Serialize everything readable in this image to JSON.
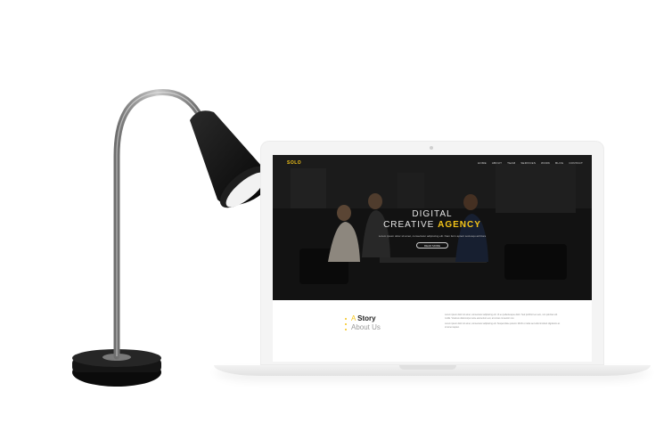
{
  "site": {
    "logo": "SOLO",
    "nav": [
      "HOME",
      "ABOUT",
      "TEAM",
      "SERVICES",
      "WORK",
      "BLOG",
      "CONTACT"
    ]
  },
  "hero": {
    "title_line1": "DIGITAL",
    "title_line2_prefix": "CREATIVE",
    "title_line2_highlight": "AGENCY",
    "subtitle": "Lorem ipsum dolor sit amet, consectetur adipiscing elit. Nam ferm aptent sociosqu ad litora",
    "button": "READ MORE"
  },
  "story": {
    "heading_a": "A",
    "heading_word": "Story",
    "subheading": "About Us",
    "paragraphs": [
      "Lorem ipsum dolor sit amet, consectetur adipiscing elit. Ut eu pellentesque dolor. Sed porttitor leo sem, non pulvinar elit mollis. Vivamus ullamcorper ante elementum est, at cursus mi auctor non.",
      "Lorem ipsum dolor sit amet, consectetur adipiscing elit. Suspendisse potenti. Morbi ut nulla sed odio tincidunt dignissim ac sit amet sapien."
    ]
  },
  "colors": {
    "accent": "#f5c518",
    "hero_bg": "#1b1b1b",
    "lamp_shade": "#141414",
    "lamp_arm": "#8a8a8a"
  },
  "icons": [
    "desk-lamp",
    "laptop"
  ]
}
